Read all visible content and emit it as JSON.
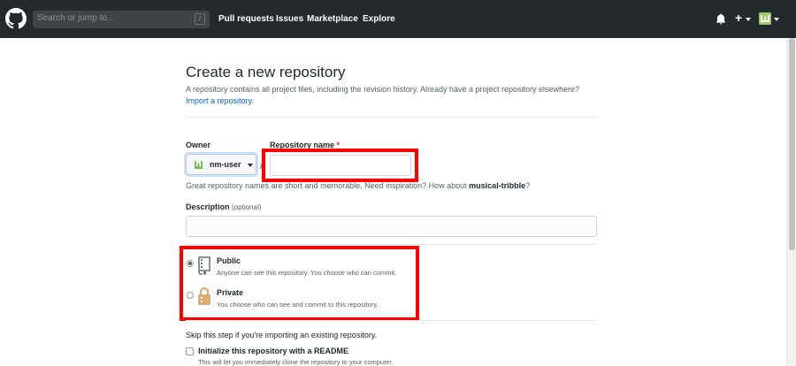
{
  "header": {
    "search_placeholder": "Search or jump to...",
    "search_shortcut": "/",
    "nav": [
      "Pull requests",
      "Issues",
      "Marketplace",
      "Explore"
    ],
    "icons": [
      "github-logo-icon",
      "bell-icon",
      "plus-icon",
      "avatar"
    ]
  },
  "form": {
    "title": "Create a new repository",
    "subtitle": "A repository contains all project files, including the revision history. Already have a project repository elsewhere?",
    "import_link": "Import a repository.",
    "owner_label": "Owner",
    "owner_value": "nm-user",
    "slash": "/",
    "repo_name_label": "Repository name",
    "required_mark": "*",
    "repo_name_value": "",
    "help_text": "Great repository names are short and memorable. Need inspiration? How about ",
    "suggestion": "musical-tribble",
    "help_end": "?",
    "description_label": "Description",
    "description_optional": "(optional)",
    "description_value": "",
    "visibility": {
      "public_title": "Public",
      "public_desc": "Anyone can see this repository. You choose who can commit.",
      "private_title": "Private",
      "private_desc": "You choose who can see and commit to this repository.",
      "selected": "Public"
    },
    "skip_text": "Skip this step if you're importing an existing repository.",
    "init_label": "Initialize this repository with a README",
    "init_desc": "This will let you immediately clone the repository to your computer."
  },
  "colors": {
    "header_bg": "#24292e",
    "link": "#0366d6",
    "highlight": "#ff0000",
    "avatar": "#9ac86b",
    "lock": "#dbab79"
  }
}
